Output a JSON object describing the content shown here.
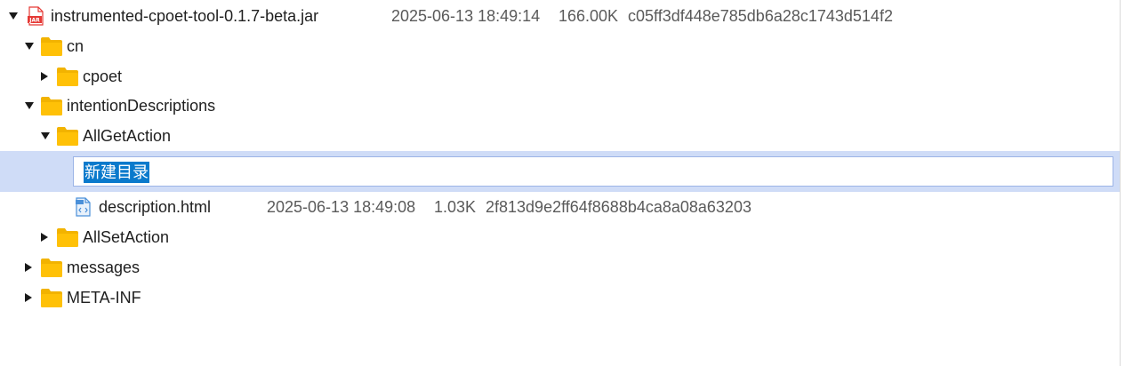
{
  "tree": {
    "root": {
      "name": "instrumented-cpoet-tool-0.1.7-beta.jar",
      "date": "2025-06-13 18:49:14",
      "size": "166.00K",
      "hash": "c05ff3df448e785db6a28c1743d514f2",
      "icon": "jar-file-icon",
      "expanded": true
    },
    "cn": {
      "name": "cn",
      "expanded": true
    },
    "cpoet": {
      "name": "cpoet",
      "expanded": false
    },
    "intention_descriptions": {
      "name": "intentionDescriptions",
      "expanded": true
    },
    "all_get_action": {
      "name": "AllGetAction",
      "expanded": true
    },
    "new_folder_edit": {
      "value": "新建目录"
    },
    "description_html": {
      "name": "description.html",
      "date": "2025-06-13 18:49:08",
      "size": "1.03K",
      "hash": "2f813d9e2ff64f8688b4ca8a08a63203",
      "icon": "html-file-icon"
    },
    "all_set_action": {
      "name": "AllSetAction",
      "expanded": false
    },
    "messages": {
      "name": "messages",
      "expanded": false
    },
    "meta_inf": {
      "name": "META-INF",
      "expanded": false
    }
  },
  "colors": {
    "folder": "#ffc107",
    "folder_tab": "#f2b300",
    "selection_row": "#cfdcf7",
    "edit_highlight": "#0a7acc",
    "jar_icon": "#e53935",
    "html_icon": "#4a90d9"
  }
}
